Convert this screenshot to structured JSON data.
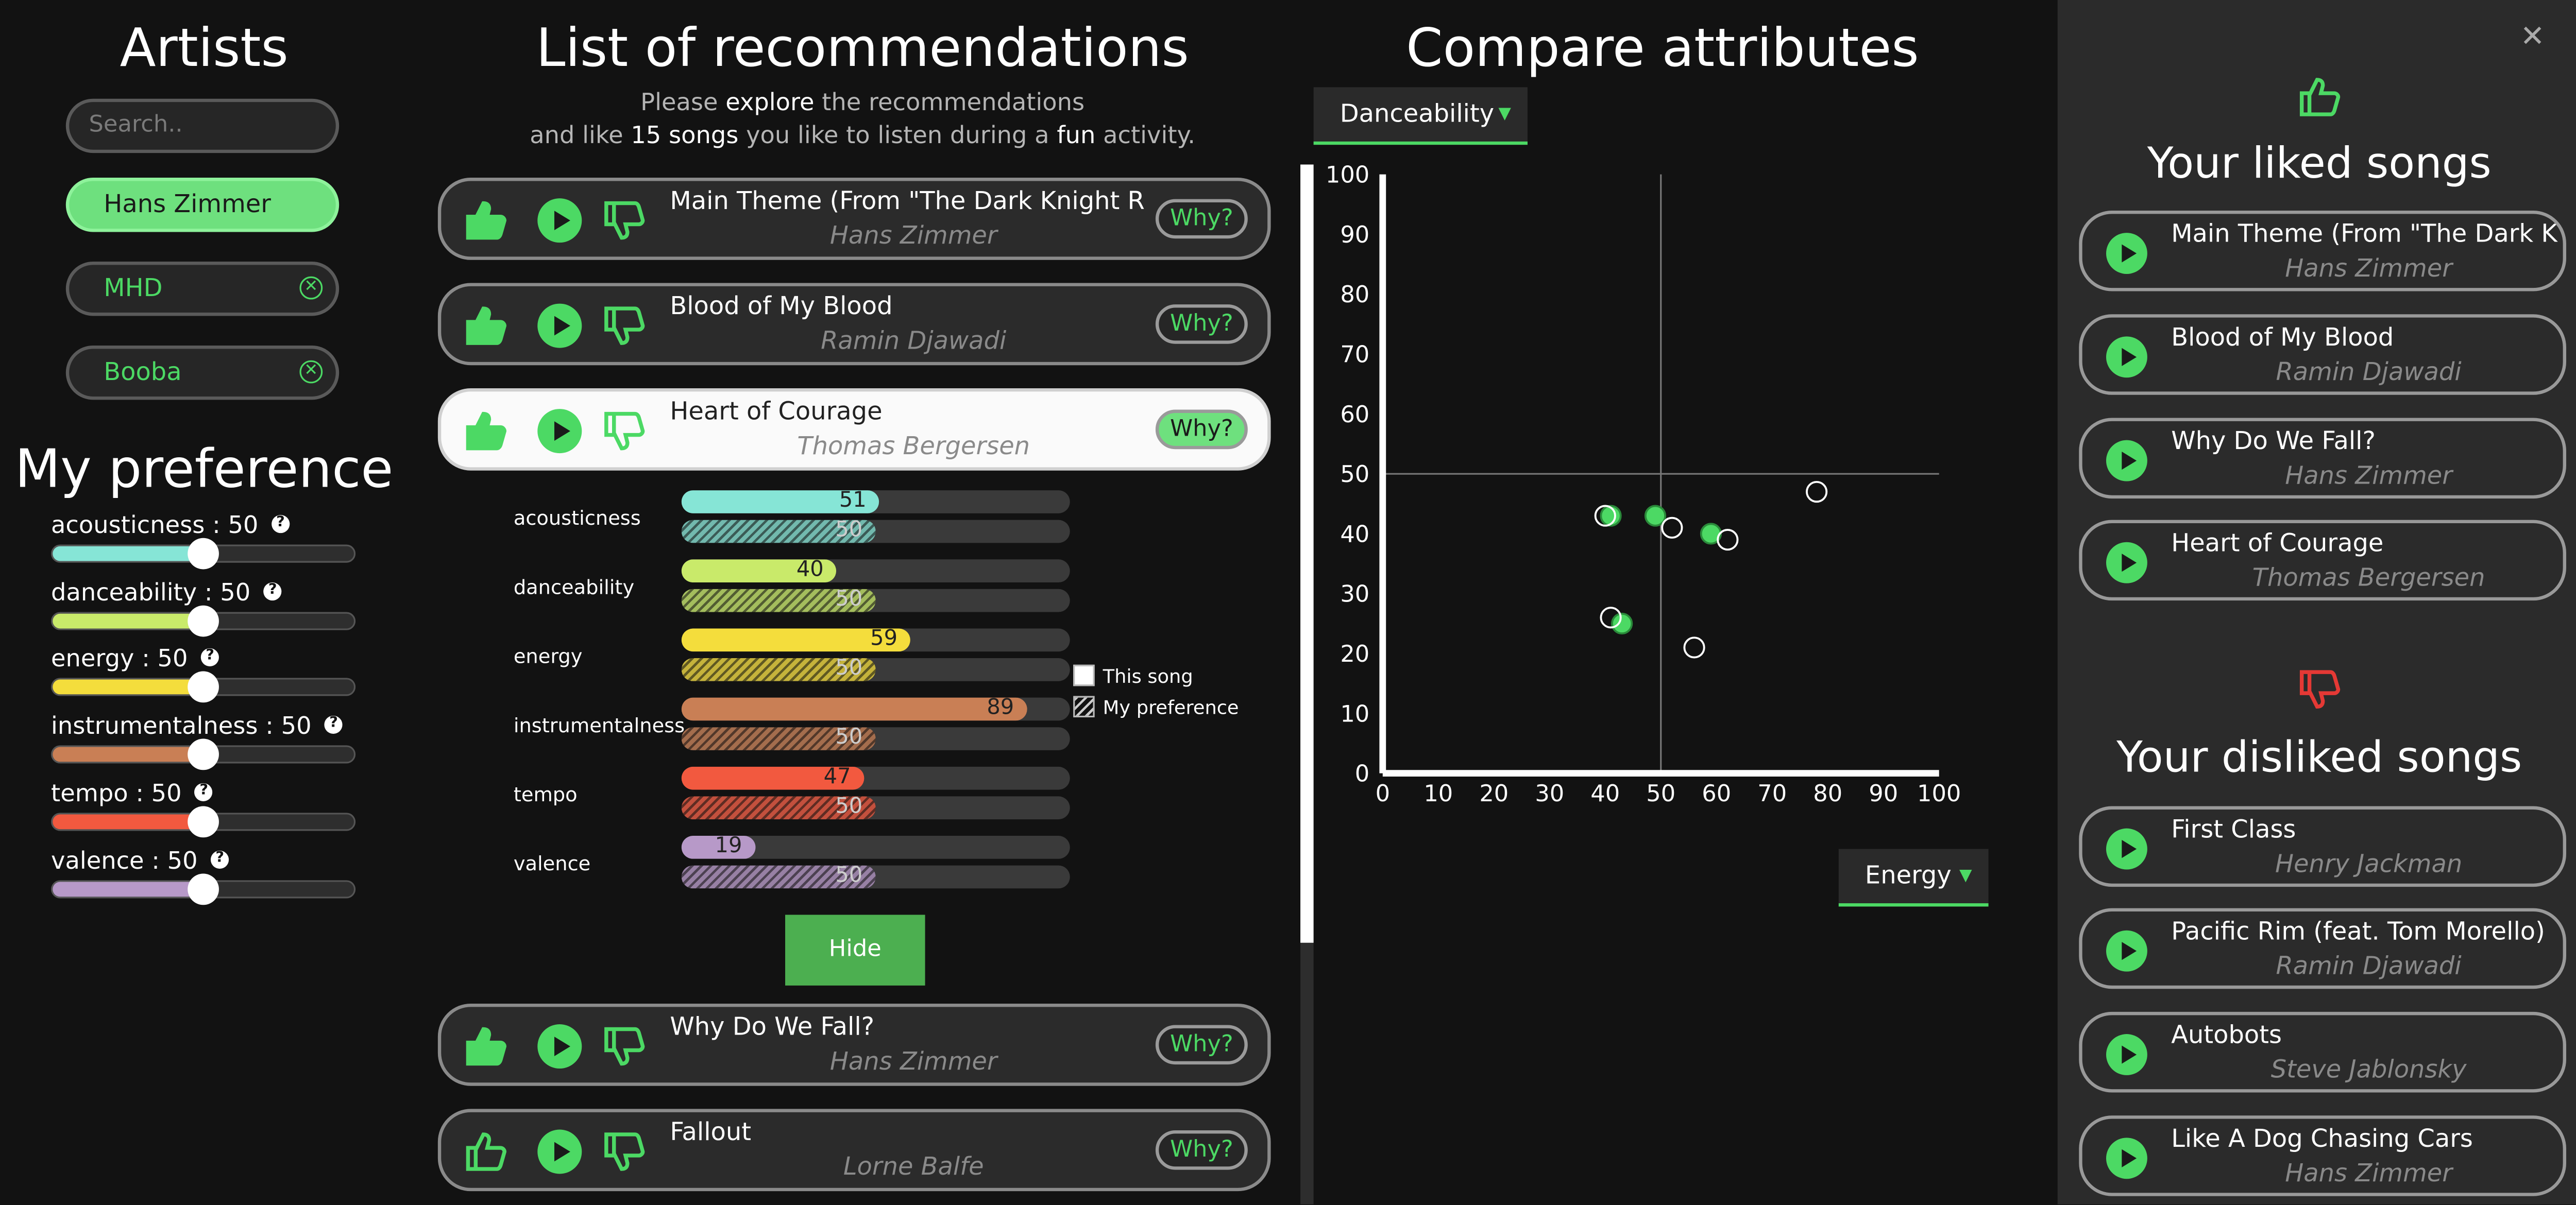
{
  "artists": {
    "title": "Artists",
    "search_placeholder": "Search..",
    "items": [
      {
        "name": "Hans Zimmer",
        "active": true
      },
      {
        "name": "MHD",
        "active": false
      },
      {
        "name": "Booba",
        "active": false
      }
    ]
  },
  "preference": {
    "title": "My preference",
    "items": [
      {
        "label": "acousticness : 50",
        "value": 50,
        "color": "#86e5d6"
      },
      {
        "label": "danceability : 50",
        "value": 50,
        "color": "#c9ea6a"
      },
      {
        "label": "energy : 50",
        "value": 50,
        "color": "#f4dd3c"
      },
      {
        "label": "instrumentalness : 50",
        "value": 50,
        "color": "#c97f55"
      },
      {
        "label": "tempo : 50",
        "value": 50,
        "color": "#f2593f"
      },
      {
        "label": "valence : 50",
        "value": 50,
        "color": "#b799c8"
      }
    ]
  },
  "recommendations": {
    "title": "List of recommendations",
    "subtitle_line1_pre": "Please ",
    "subtitle_line1_b": "explore",
    "subtitle_line1_post": " the recommendations",
    "subtitle_line2_a": "and like ",
    "subtitle_line2_b": "15 songs",
    "subtitle_line2_c": " you like to listen during a ",
    "subtitle_line2_d": "fun",
    "subtitle_line2_e": " activity.",
    "why_label": "Why?",
    "hide_label": "Hide",
    "songs": [
      {
        "title": "Main Theme (From \"The Dark Knight R",
        "artist": "Hans Zimmer"
      },
      {
        "title": "Blood of My Blood",
        "artist": "Ramin Djawadi"
      },
      {
        "title": "Heart of Courage",
        "artist": "Thomas Bergersen"
      },
      {
        "title": "Why Do We Fall?",
        "artist": "Hans Zimmer"
      },
      {
        "title": "Fallout",
        "artist": "Lorne Balfe"
      }
    ],
    "details": [
      {
        "name": "acousticness",
        "song": 51,
        "pref": 50,
        "color": "#86e5d6"
      },
      {
        "name": "danceability",
        "song": 40,
        "pref": 50,
        "color": "#c9ea6a"
      },
      {
        "name": "energy",
        "song": 59,
        "pref": 50,
        "color": "#f4dd3c"
      },
      {
        "name": "instrumentalness",
        "song": 89,
        "pref": 50,
        "color": "#c97f55"
      },
      {
        "name": "tempo",
        "song": 47,
        "pref": 50,
        "color": "#f2593f"
      },
      {
        "name": "valence",
        "song": 19,
        "pref": 50,
        "color": "#b799c8"
      }
    ],
    "legend_song": "This song",
    "legend_pref": "My preference"
  },
  "compare": {
    "title": "Compare attributes",
    "y_dropdown": "Danceability",
    "x_dropdown": "Energy"
  },
  "chart_data": {
    "type": "scatter",
    "xlim": [
      0,
      100
    ],
    "ylim": [
      0,
      100
    ],
    "x_ticks": [
      "0",
      "10",
      "20",
      "30",
      "40",
      "50",
      "60",
      "70",
      "80",
      "90",
      "100"
    ],
    "y_ticks": [
      "0",
      "10",
      "20",
      "30",
      "40",
      "50",
      "60",
      "70",
      "80",
      "90",
      "100"
    ],
    "crosshair": {
      "x": 50,
      "y": 50
    },
    "series": [
      {
        "color": "#4cd964",
        "filled": true,
        "points": [
          [
            41,
            43
          ],
          [
            49,
            43
          ],
          [
            59,
            40
          ],
          [
            43,
            25
          ]
        ]
      },
      {
        "color": "#ffffff",
        "filled": false,
        "points": [
          [
            40,
            43
          ],
          [
            52,
            41
          ],
          [
            62,
            39
          ],
          [
            41,
            26
          ],
          [
            56,
            21
          ],
          [
            78,
            47
          ]
        ]
      }
    ]
  },
  "liked": {
    "title": "Your liked songs",
    "songs": [
      {
        "title": "Main Theme (From \"The Dark K",
        "artist": "Hans Zimmer"
      },
      {
        "title": "Blood of My Blood",
        "artist": "Ramin Djawadi"
      },
      {
        "title": "Why Do We Fall?",
        "artist": "Hans Zimmer"
      },
      {
        "title": "Heart of Courage",
        "artist": "Thomas Bergersen"
      }
    ]
  },
  "disliked": {
    "title": "Your disliked songs",
    "songs": [
      {
        "title": "First Class",
        "artist": "Henry Jackman"
      },
      {
        "title": "Pacific Rim (feat. Tom Morello)",
        "artist": "Ramin Djawadi"
      },
      {
        "title": "Autobots",
        "artist": "Steve Jablonsky"
      },
      {
        "title": "Like A Dog Chasing Cars",
        "artist": "Hans Zimmer"
      }
    ]
  },
  "panel": {
    "close_glyph": "✕"
  },
  "colors": {
    "accent": "#4cd964",
    "dislike": "#e53935",
    "bg": "#121212",
    "panel": "#2b2b2b"
  }
}
